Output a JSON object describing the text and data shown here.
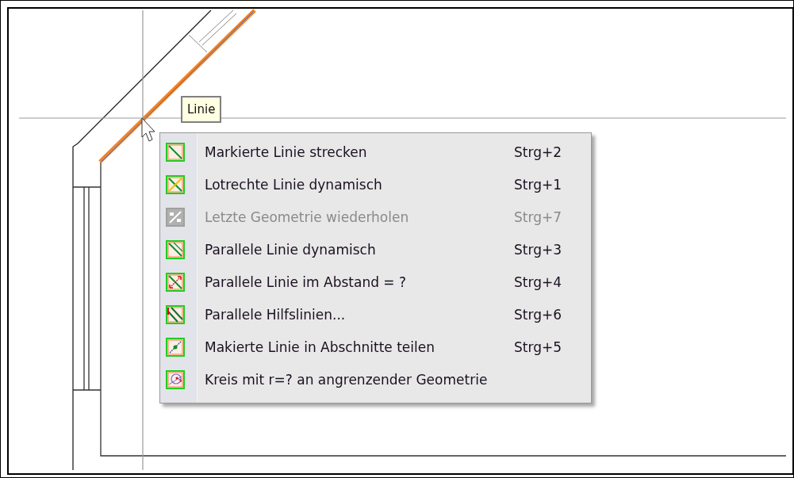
{
  "tooltip": {
    "text": "Linie"
  },
  "context_menu": {
    "items": [
      {
        "kind": "stretch",
        "label": "Markierte Linie strecken",
        "shortcut": "Strg+2",
        "disabled": false
      },
      {
        "kind": "perpendicular",
        "label": "Lotrechte Linie dynamisch",
        "shortcut": "Strg+1",
        "disabled": false
      },
      {
        "kind": "repeat",
        "label": "Letzte Geometrie wiederholen",
        "shortcut": "Strg+7",
        "disabled": true
      },
      {
        "kind": "parallel",
        "label": "Parallele Linie dynamisch",
        "shortcut": "Strg+3",
        "disabled": false
      },
      {
        "kind": "distance",
        "label": "Parallele Linie im Abstand = ?",
        "shortcut": "Strg+4",
        "disabled": false
      },
      {
        "kind": "helpers",
        "label": "Parallele Hilfslinien...",
        "shortcut": "Strg+6",
        "disabled": false
      },
      {
        "kind": "divide",
        "label": "Makierte Linie in Abschnitte teilen",
        "shortcut": "Strg+5",
        "disabled": false
      },
      {
        "kind": "circle",
        "label": "Kreis mit r=? an angrenzender Geometrie",
        "disabled": false
      }
    ]
  }
}
